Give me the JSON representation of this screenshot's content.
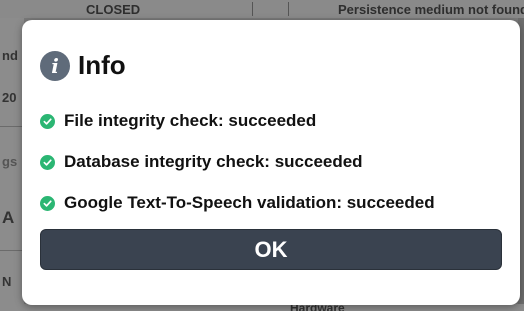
{
  "background": {
    "top_left_text": "CLOSED",
    "top_right_text": "Persistence medium not found",
    "left_fragments": [
      "nd",
      "20",
      "gs",
      "A",
      "N"
    ],
    "bottom_text": "Hardware"
  },
  "dialog": {
    "title": "Info",
    "icon": "info-icon",
    "checks": [
      {
        "icon": "check-circle-icon",
        "text": "File integrity check: succeeded"
      },
      {
        "icon": "check-circle-icon",
        "text": "Database integrity check: succeeded"
      },
      {
        "icon": "check-circle-icon",
        "text": "Google Text-To-Speech validation: succeeded"
      }
    ],
    "ok_label": "OK"
  },
  "colors": {
    "success": "#2bb673",
    "button": "#3a4350",
    "info_icon": "#5f6b7a"
  }
}
